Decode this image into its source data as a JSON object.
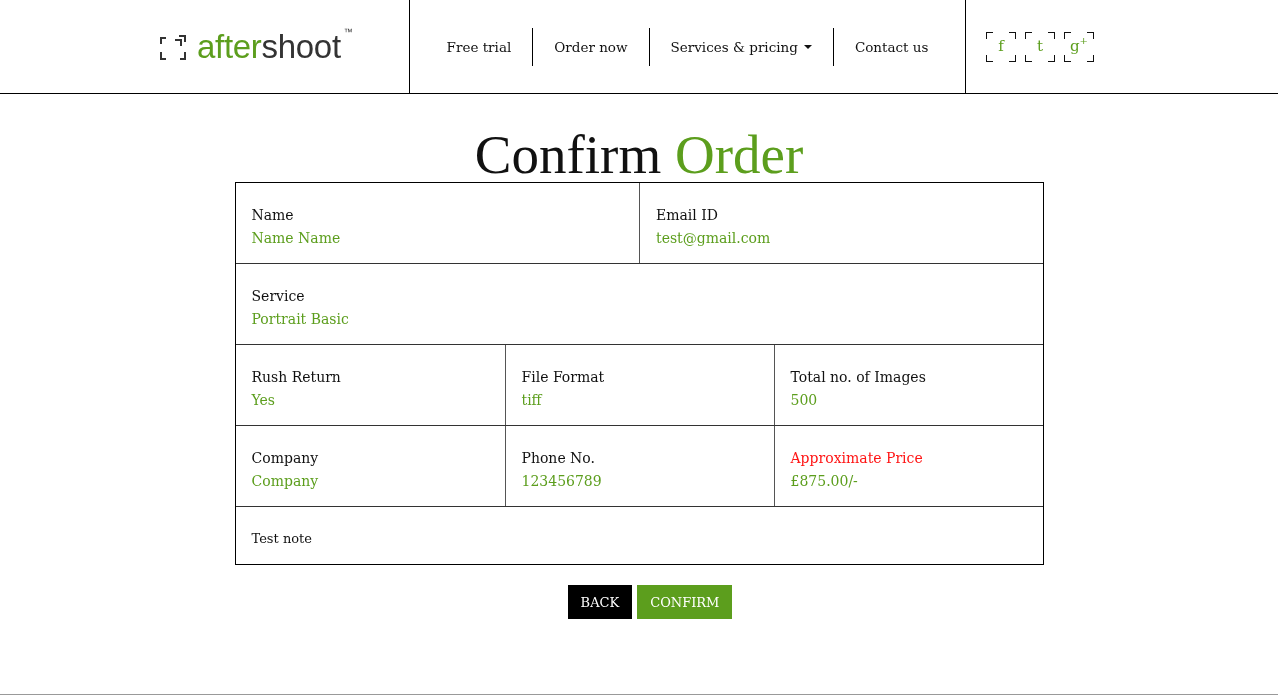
{
  "header": {
    "logo": {
      "parts": [
        {
          "text": "after",
          "color": "#5c9e1d"
        },
        {
          "text": "shoot",
          "color": "#333333"
        }
      ],
      "trademark": "™"
    },
    "nav": [
      {
        "label": "Free trial",
        "dropdown": false
      },
      {
        "label": "Order now",
        "dropdown": false
      },
      {
        "label": "Services & pricing",
        "dropdown": true
      },
      {
        "label": "Contact us",
        "dropdown": false
      }
    ],
    "social": [
      {
        "label": "f"
      },
      {
        "label": "t"
      },
      {
        "label": "g$^{+}$"
      }
    ]
  },
  "title": {
    "text": "Confirm",
    "highlight": "Order"
  },
  "order_details": {
    "rows": [
      {
        "fields": [
          {
            "label": "Name",
            "value": "Name Name",
            "highlighted": false
          },
          {
            "label": "Email ID",
            "value": "test@gmail.com",
            "highlighted": false
          }
        ]
      },
      {
        "fields": [
          {
            "label": "Service",
            "value": "Portrait Basic",
            "highlighted": false
          }
        ]
      },
      {
        "fields": [
          {
            "label": "Rush Return",
            "value": "Yes",
            "highlighted": false
          },
          {
            "label": "File Format",
            "value": "tiff",
            "highlighted": false
          },
          {
            "label": "Total no. of Images",
            "value": "500",
            "highlighted": false
          }
        ]
      },
      {
        "fields": [
          {
            "label": "Company",
            "value": "Company",
            "highlighted": false
          },
          {
            "label": "Phone No.",
            "value": "123456789",
            "highlighted": false
          },
          {
            "label": "Approximate Price",
            "value": "£875.00/-",
            "highlighted": true
          }
        ]
      }
    ],
    "note": "Test note"
  },
  "buttons": [
    {
      "label": "BACK",
      "kind": "secondary"
    },
    {
      "label": "CONFIRM",
      "kind": "primary"
    }
  ]
}
